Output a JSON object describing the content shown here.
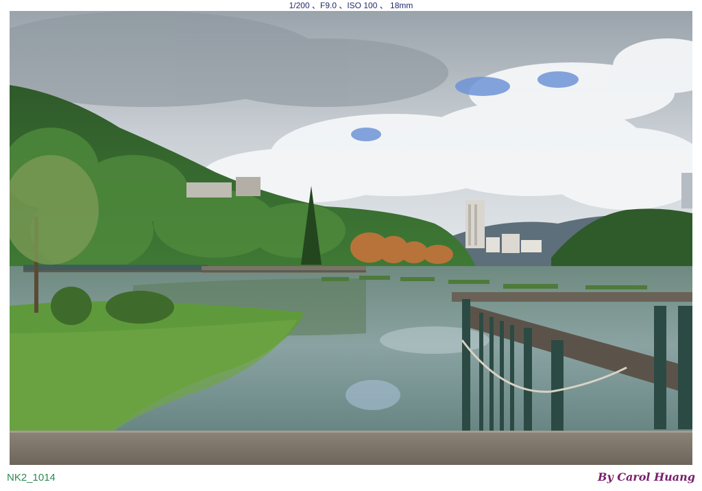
{
  "photo": {
    "exif_caption": "1/200 、F9.0 、ISO 100 、 18mm",
    "file_id": "NK2_1014",
    "credit": "By Carol Huang",
    "colors": {
      "caption": "#1f2a6b",
      "file_id": "#2d8a55",
      "credit": "#7a1f6e"
    }
  }
}
